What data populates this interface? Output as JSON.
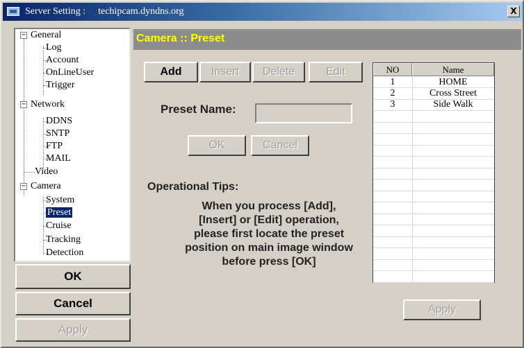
{
  "titlebar": {
    "label": "Server Setting :",
    "host": "techipcam.dyndns.org",
    "close": "X"
  },
  "tree": {
    "general": "General",
    "log": "Log",
    "account": "Account",
    "onlineuser": "OnLineUser",
    "trigger": "Trigger",
    "network": "Network",
    "ddns": "DDNS",
    "sntp": "SNTP",
    "ftp": "FTP",
    "mail": "MAIL",
    "video": "Video",
    "camera": "Camera",
    "system": "System",
    "preset": "Preset",
    "cruise": "Cruise",
    "tracking": "Tracking",
    "detection": "Detection",
    "collapse_symbol": "−"
  },
  "left_buttons": {
    "ok": "OK",
    "cancel": "Cancel",
    "apply": "Apply"
  },
  "header": {
    "title": "Camera :: Preset"
  },
  "toolbar": {
    "add": "Add",
    "insert": "Insert",
    "delete": "Delete",
    "edit": "Edit"
  },
  "form": {
    "preset_name_label": "Preset Name:",
    "preset_name_value": "",
    "ok": "OK",
    "cancel": "Cancel"
  },
  "tips": {
    "heading": "Operational Tips:",
    "lines": [
      "When you process [Add],",
      "[Insert] or [Edit] operation,",
      "please first locate the preset",
      "position on main image window",
      "before press [OK]"
    ]
  },
  "table": {
    "headers": {
      "no": "NO",
      "name": "Name"
    },
    "rows": [
      {
        "no": "1",
        "name": "HOME"
      },
      {
        "no": "2",
        "name": "Cross Street"
      },
      {
        "no": "3",
        "name": "Side Walk"
      }
    ]
  },
  "apply_button": "Apply"
}
